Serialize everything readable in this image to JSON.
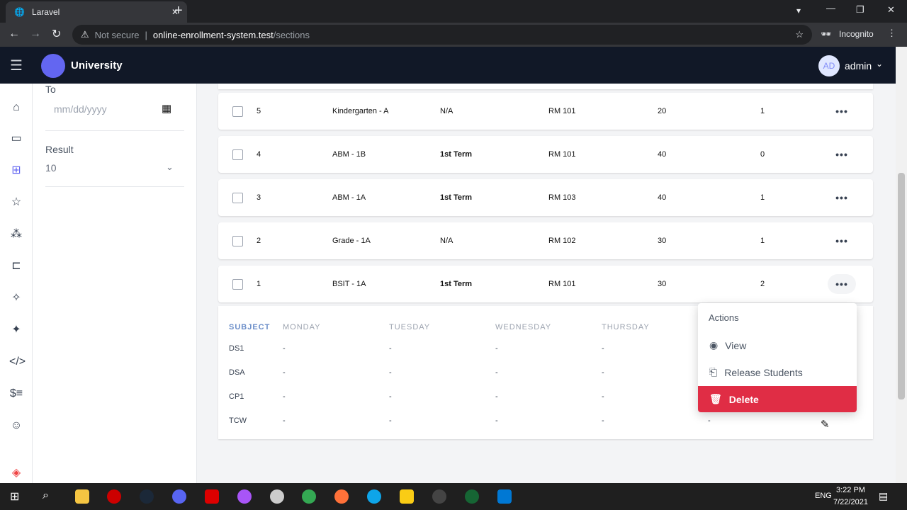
{
  "browser": {
    "tab_title": "Laravel",
    "not_secure": "Not secure",
    "url_host": "online-enrollment-system.test",
    "url_path": "/sections",
    "profile": "Incognito"
  },
  "header": {
    "brand": "University",
    "avatar": "AD",
    "user": "admin"
  },
  "filter": {
    "to_label": "To",
    "date_placeholder": "mm/dd/yyyy",
    "result_label": "Result",
    "result_value": "10"
  },
  "rows": [
    {
      "id": "5",
      "name": "Kindergarten - A",
      "term": "N/A",
      "room": "RM 101",
      "capacity": "20",
      "students": "1"
    },
    {
      "id": "4",
      "name": "ABM - 1B",
      "term": "1st Term",
      "room": "RM 101",
      "capacity": "40",
      "students": "0"
    },
    {
      "id": "3",
      "name": "ABM - 1A",
      "term": "1st Term",
      "room": "RM 103",
      "capacity": "40",
      "students": "1"
    },
    {
      "id": "2",
      "name": "Grade - 1A",
      "term": "N/A",
      "room": "RM 102",
      "capacity": "30",
      "students": "1"
    },
    {
      "id": "1",
      "name": "BSIT - 1A",
      "term": "1st Term",
      "room": "RM 101",
      "capacity": "30",
      "students": "2"
    }
  ],
  "schedule": {
    "headers": [
      "SUBJECT",
      "MONDAY",
      "TUESDAY",
      "WEDNESDAY",
      "THURSDAY"
    ],
    "rows": [
      [
        "DS1",
        "-",
        "-",
        "-",
        "-"
      ],
      [
        "DSA",
        "-",
        "-",
        "-",
        "-"
      ],
      [
        "CP1",
        "-",
        "-",
        "-",
        "-"
      ],
      [
        "TCW",
        "-",
        "-",
        "-",
        "-",
        "-"
      ]
    ]
  },
  "menu": {
    "title": "Actions",
    "view": "View",
    "release": "Release Students",
    "delete": "Delete"
  },
  "taskbar": {
    "lang": "ENG",
    "time": "3:22 PM",
    "date": "7/22/2021"
  },
  "colors": {
    "accent": "#6366f1",
    "danger": "#e02d45",
    "header": "#111827"
  }
}
